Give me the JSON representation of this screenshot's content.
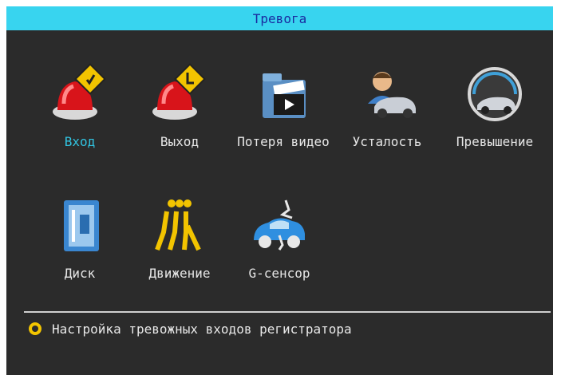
{
  "title": "Тревога",
  "menu": [
    {
      "label": "Вход",
      "icon": "alarm-in-icon",
      "selected": true
    },
    {
      "label": "Выход",
      "icon": "alarm-out-icon",
      "selected": false
    },
    {
      "label": "Потеря видео",
      "icon": "video-loss-icon",
      "selected": false
    },
    {
      "label": "Усталость",
      "icon": "fatigue-driver-icon",
      "selected": false
    },
    {
      "label": "Превышение",
      "icon": "overspeed-icon",
      "selected": false
    },
    {
      "label": "Диск",
      "icon": "disk-icon",
      "selected": false
    },
    {
      "label": "Движение",
      "icon": "motion-icon",
      "selected": false
    },
    {
      "label": "G-сенсор",
      "icon": "g-sensor-icon",
      "selected": false
    }
  ],
  "hint": "Настройка тревожных входов регистратора",
  "colors": {
    "titlebar": "#38d4ef",
    "title_text": "#1a2aa0",
    "selected_label": "#31c3e0",
    "background": "#2b2b2b"
  }
}
